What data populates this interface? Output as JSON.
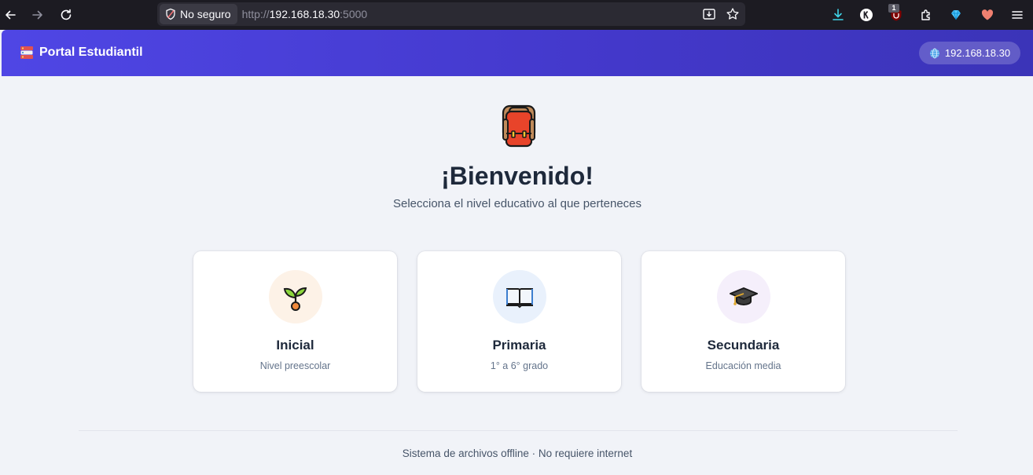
{
  "browser": {
    "security_label": "No seguro",
    "url_scheme": "http://",
    "url_host": "192.168.18.30",
    "url_port": ":5000",
    "extension_badge": "1"
  },
  "header": {
    "brand": "Portal Estudiantil",
    "ip": "192.168.18.30",
    "gradient_start": "#4f46e5",
    "gradient_end": "#3b34b8"
  },
  "hero": {
    "icon": "backpack-icon",
    "title": "¡Bienvenido!",
    "subtitle": "Selecciona el nivel educativo al que perteneces"
  },
  "levels": [
    {
      "icon": "seedling-icon",
      "title": "Inicial",
      "subtitle": "Nivel preescolar",
      "circle_color": "#fdf2e7"
    },
    {
      "icon": "open-book-icon",
      "title": "Primaria",
      "subtitle": "1° a 6° grado",
      "circle_color": "#e9f1fc"
    },
    {
      "icon": "graduation-cap-icon",
      "title": "Secundaria",
      "subtitle": "Educación media",
      "circle_color": "#f5effb"
    }
  ],
  "footer": {
    "text": "Sistema de archivos offline · No requiere internet"
  }
}
